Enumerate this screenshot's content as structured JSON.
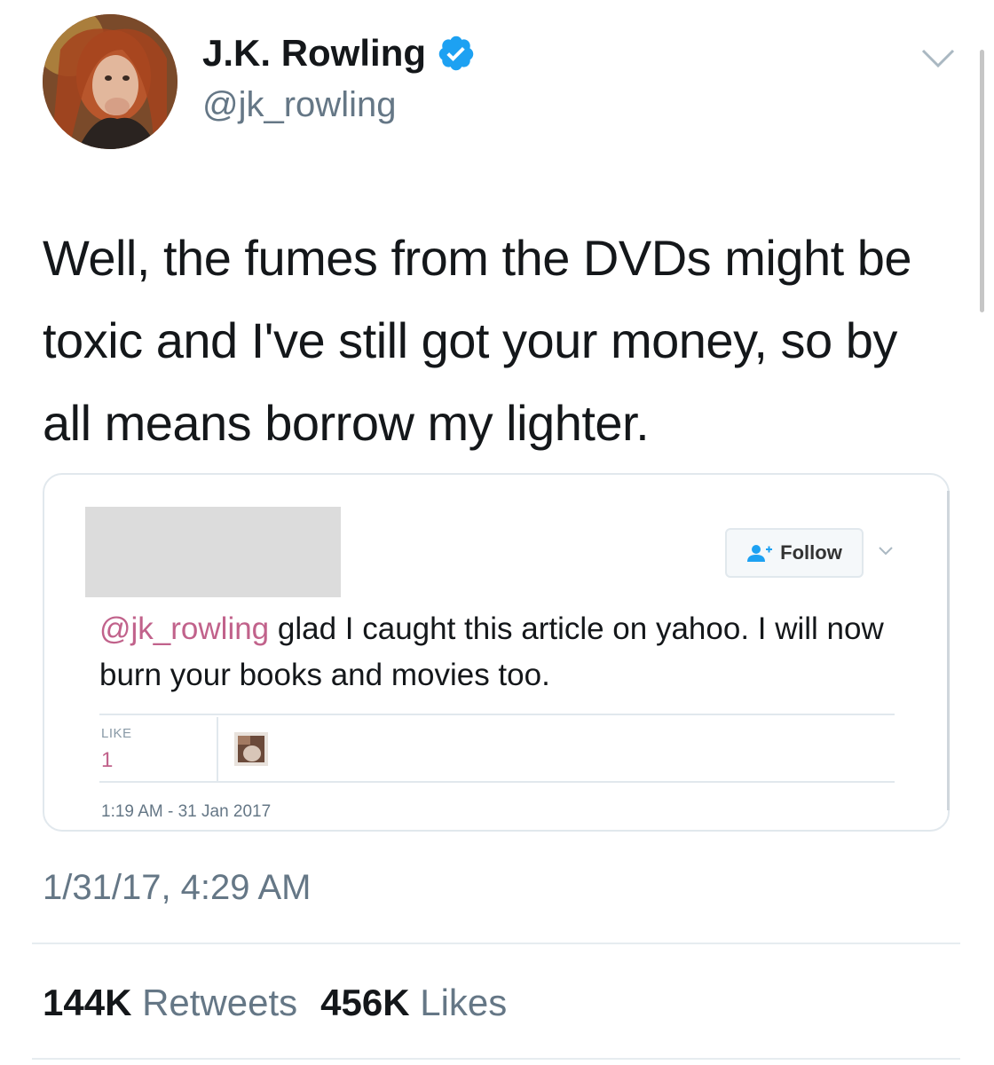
{
  "author": {
    "name": "J.K. Rowling",
    "handle": "@jk_rowling",
    "verified": true,
    "verified_icon": "verified-badge-icon"
  },
  "tweet": {
    "text": "Well, the fumes from the DVDs might be toxic and I've still got your money, so by all means borrow my lighter.",
    "timestamp": "1/31/17, 4:29 AM"
  },
  "quoted": {
    "follow_label": "Follow",
    "mention": "@jk_rowling",
    "text": " glad I caught this article on yahoo. I will now burn your books and movies too.",
    "like_label": "LIKE",
    "like_count": "1",
    "date": "1:19 AM - 31 Jan 2017"
  },
  "stats": {
    "retweets_count": "144K",
    "retweets_label": "Retweets",
    "likes_count": "456K",
    "likes_label": "Likes"
  },
  "colors": {
    "accent_blue": "#1da1f2",
    "mention_pink": "#c1628b",
    "secondary_gray": "#657786"
  }
}
